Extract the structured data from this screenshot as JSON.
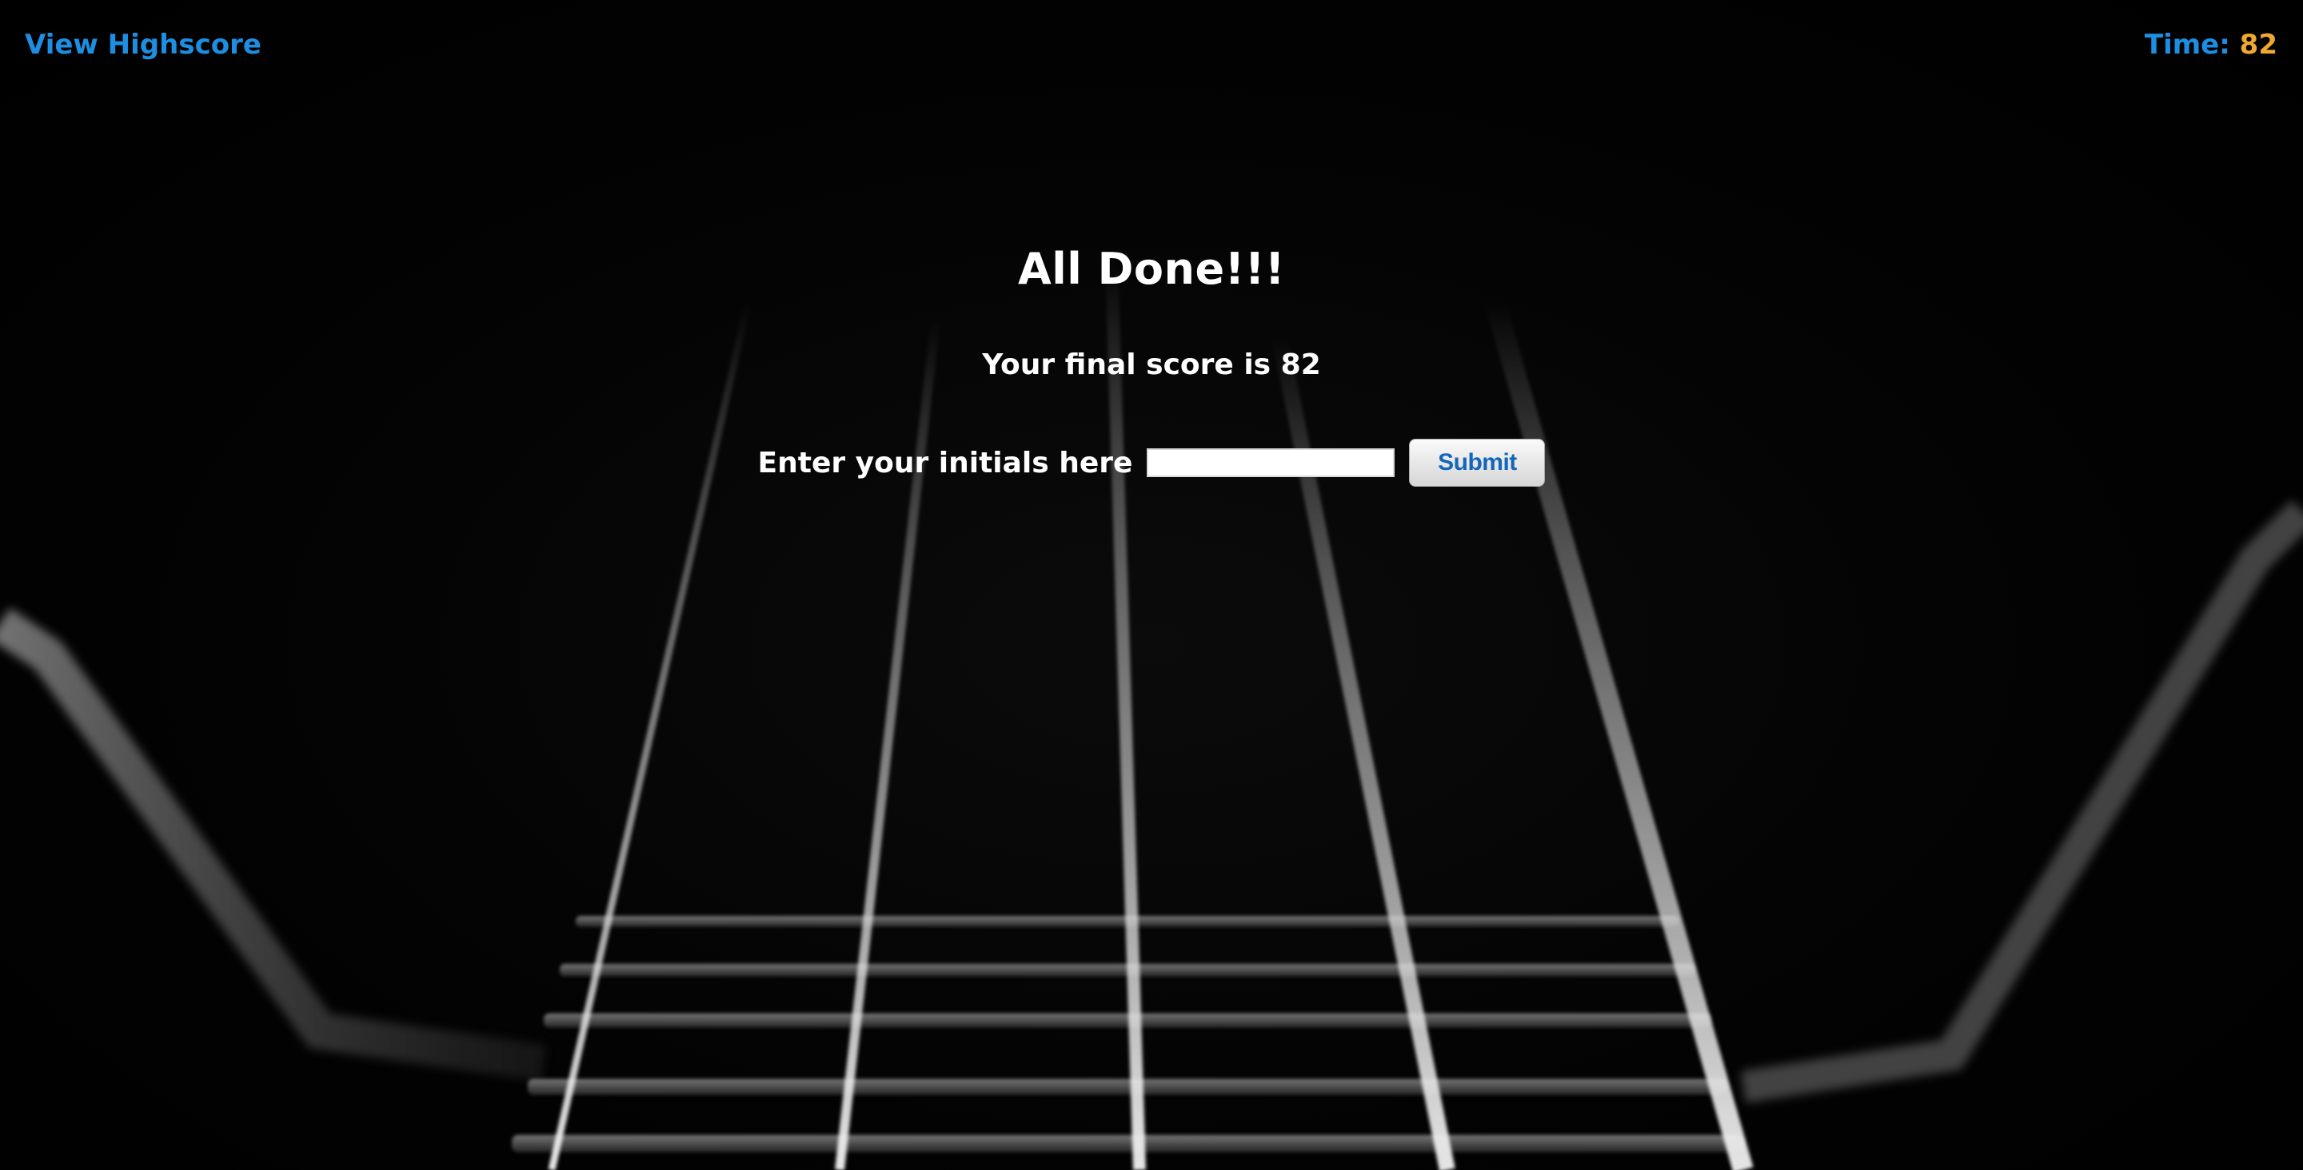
{
  "nav": {
    "highscore_label": "View Highscore"
  },
  "timer": {
    "label": "Time:",
    "value": "82"
  },
  "result": {
    "title": "All Done!!!",
    "score_text": "Your final score is 82"
  },
  "form": {
    "initials_label": "Enter your initials here",
    "initials_value": "",
    "submit_label": "Submit"
  },
  "colors": {
    "accent_blue": "#1c8fe3",
    "timer_orange": "#f0a830",
    "background": "#000000",
    "button_text": "#1566b8"
  },
  "background_image": "guitar-strings-photo"
}
